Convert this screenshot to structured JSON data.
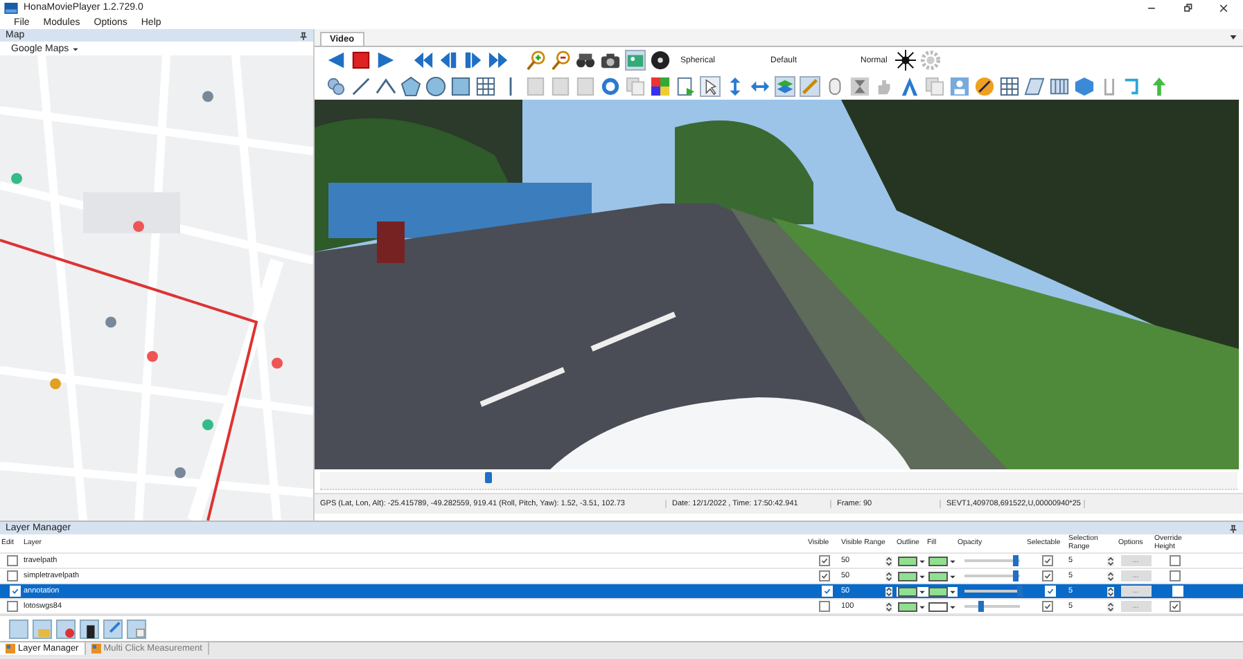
{
  "window": {
    "title": "HonaMoviePlayer 1.2.729.0"
  },
  "menu": [
    "File",
    "Modules",
    "Options",
    "Help"
  ],
  "map_panel": {
    "title": "Map",
    "provider": "Google Maps"
  },
  "video_panel": {
    "tab": "Video",
    "projection": "Spherical",
    "preset": "Default",
    "mode": "Normal",
    "timeline": {
      "level": 0.18
    },
    "status": [
      "GPS (Lat, Lon, Alt): -25.415789, -49.282559, 919.41  (Roll, Pitch, Yaw): 1.52, -3.51, 102.73",
      "Date: 12/1/2022 , Time: 17:50:42.941",
      "Frame: 90",
      "SEVT1,409708,691522,U,00000940*25"
    ]
  },
  "layer_manager": {
    "title": "Layer Manager",
    "columns": [
      "Edit",
      "Layer",
      "Visible",
      "Visible Range",
      "Outline",
      "Fill",
      "Opacity",
      "Selectable",
      "Selection Range",
      "Options",
      "Override Height"
    ],
    "rows": [
      {
        "selected": false,
        "edit": false,
        "layer": "travelpath",
        "visible": true,
        "visible_range": "50",
        "outline": {
          "color": "#8fe08f"
        },
        "fill": {
          "color": "#8fe08f"
        },
        "opacity": {
          "level": 0.93
        },
        "selectable": true,
        "selection_range": "5",
        "options": "...",
        "override_height": false
      },
      {
        "selected": false,
        "edit": false,
        "layer": "simpletravelpath",
        "visible": true,
        "visible_range": "50",
        "outline": {
          "color": "#8fe08f"
        },
        "fill": {
          "color": "#8fe08f"
        },
        "opacity": {
          "level": 0.93
        },
        "selectable": true,
        "selection_range": "5",
        "options": "...",
        "override_height": false
      },
      {
        "selected": true,
        "edit": true,
        "layer": "annotation",
        "visible": true,
        "visible_range": "50",
        "outline": {
          "color": "#8fe08f"
        },
        "fill": {
          "color": "#8fe08f"
        },
        "opacity": {
          "level": 1
        },
        "selectable": true,
        "selection_range": "5",
        "options": "...",
        "override_height": false
      },
      {
        "selected": false,
        "edit": false,
        "layer": "lotoswgs84",
        "visible": false,
        "visible_range": "100",
        "outline": {
          "color": "#8fe08f"
        },
        "fill": {
          "color": "#ffffff"
        },
        "opacity": {
          "level": 0.3
        },
        "selectable": true,
        "selection_range": "5",
        "options": "...",
        "override_height": true
      }
    ]
  },
  "bottom_tabs": [
    {
      "label": "Layer Manager",
      "selected": true
    },
    {
      "label": "Multi Click Measurement",
      "selected": false
    }
  ]
}
